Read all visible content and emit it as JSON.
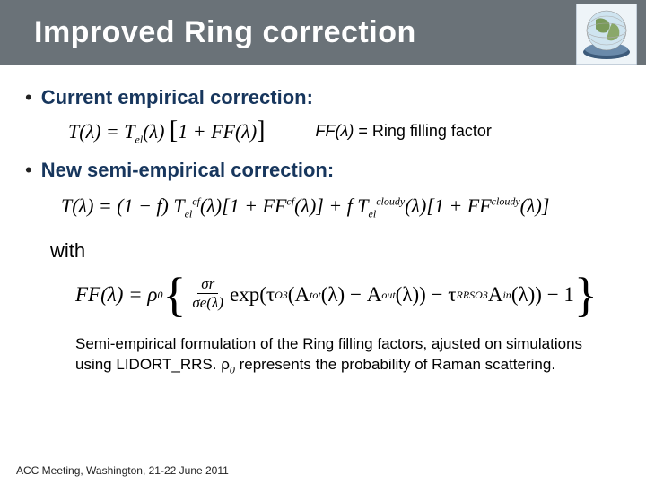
{
  "header": {
    "title": "Improved Ring correction"
  },
  "bullets": {
    "b1": "Current empirical correction:",
    "b2": "New semi-empirical correction:"
  },
  "eq": {
    "eq1": "T(λ) = Tₑₗ(λ) [1 + FF(λ)]",
    "ff_label_ital": "FF(λ)",
    "ff_label_rest": " = Ring filling factor",
    "eq2_a": "T(λ) = (1 − f) T",
    "eq2_b": "(λ)[1 + FF",
    "eq2_c": "(λ)] + f T",
    "eq2_d": "(λ)[1 + FF",
    "eq2_e": "(λ)]",
    "sup_cf": "cf",
    "sup_cloudy": "cloudy",
    "sub_el": "el",
    "with": "with",
    "ff_lhs": "FF(λ) = ρ",
    "zero": "0",
    "frac_num": "σr",
    "frac_den": "σe(λ)",
    "exp_a": "exp(τ",
    "sub_O3": "O3",
    "exp_b": "(A",
    "sub_tot": "tot",
    "exp_c": "(λ) − A",
    "sub_out": "out",
    "exp_d": "(λ)) − τ",
    "sup_RRS": "RRS",
    "exp_e": " A",
    "sub_in": "in",
    "exp_f": "(λ)) − 1"
  },
  "para": {
    "text_a": "Semi-empirical formulation of the Ring filling factors, ajusted on simulations using LIDORT_RRS. ρ",
    "text_b": " represents the probability of Raman scattering."
  },
  "footer": {
    "text": "ACC Meeting, Washington, 21-22 June 2011"
  }
}
